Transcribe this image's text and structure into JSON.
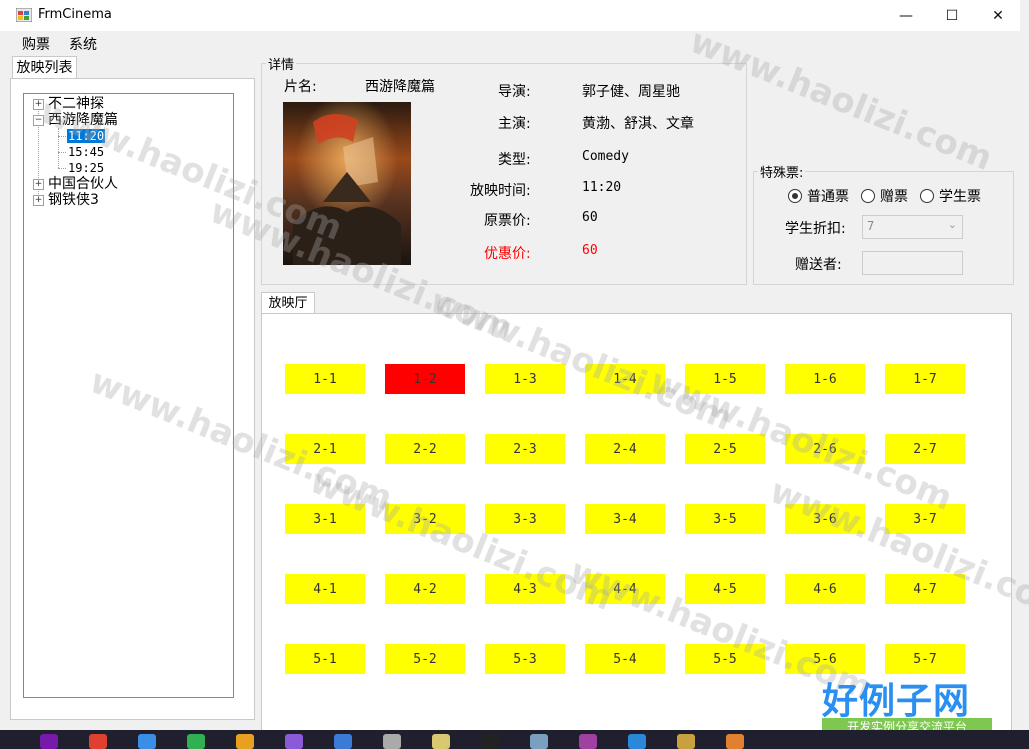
{
  "window": {
    "title": "FrmCinema",
    "minimize": "—",
    "maximize": "☐",
    "close": "✕"
  },
  "menu": [
    {
      "label": "购票"
    },
    {
      "label": "系统"
    }
  ],
  "left": {
    "tab_label": "放映列表",
    "movies": [
      {
        "label": "不二神探",
        "expander": "+"
      },
      {
        "label": "西游降魔篇",
        "expander": "−",
        "times": [
          "11:20",
          "15:45",
          "19:25"
        ]
      },
      {
        "label": "中国合伙人",
        "expander": "+"
      },
      {
        "label": "钢铁侠3",
        "expander": "+"
      }
    ]
  },
  "detail": {
    "group_title": "详情",
    "name_label": "片名:",
    "name_value": "西游降魔篇",
    "director_label": "导演:",
    "director_value": "郭子健、周星驰",
    "actor_label": "主演:",
    "actor_value": "黄渤、舒淇、文章",
    "type_label": "类型:",
    "type_value": "Comedy",
    "time_label": "放映时间:",
    "time_value": "11:20",
    "price_label": "原票价:",
    "price_value": "60",
    "discount_label": "优惠价:",
    "discount_value": "60",
    "discount_color": "#ff0000"
  },
  "special": {
    "group_title": "特殊票:",
    "radios": [
      {
        "label": "普通票",
        "checked": true
      },
      {
        "label": "赠票",
        "checked": false
      },
      {
        "label": "学生票",
        "checked": false
      }
    ],
    "student_discount_label": "学生折扣:",
    "student_discount_value": "7",
    "gift_label": "赠送者:",
    "gift_value": ""
  },
  "hall": {
    "tab_label": "放映厅",
    "seat_color": "#ffff00",
    "sold_color": "#ff0000",
    "rows": [
      [
        {
          "label": "1-1",
          "sold": false
        },
        {
          "label": "1-2",
          "sold": true
        },
        {
          "label": "1-3",
          "sold": false
        },
        {
          "label": "1-4",
          "sold": false
        },
        {
          "label": "1-5",
          "sold": false
        },
        {
          "label": "1-6",
          "sold": false
        },
        {
          "label": "1-7",
          "sold": false
        }
      ],
      [
        {
          "label": "2-1",
          "sold": false
        },
        {
          "label": "2-2",
          "sold": false
        },
        {
          "label": "2-3",
          "sold": false
        },
        {
          "label": "2-4",
          "sold": false
        },
        {
          "label": "2-5",
          "sold": false
        },
        {
          "label": "2-6",
          "sold": false
        },
        {
          "label": "2-7",
          "sold": false
        }
      ],
      [
        {
          "label": "3-1",
          "sold": false
        },
        {
          "label": "3-2",
          "sold": false
        },
        {
          "label": "3-3",
          "sold": false
        },
        {
          "label": "3-4",
          "sold": false
        },
        {
          "label": "3-5",
          "sold": false
        },
        {
          "label": "3-6",
          "sold": false
        },
        {
          "label": "3-7",
          "sold": false
        }
      ],
      [
        {
          "label": "4-1",
          "sold": false
        },
        {
          "label": "4-2",
          "sold": false
        },
        {
          "label": "4-3",
          "sold": false
        },
        {
          "label": "4-4",
          "sold": false
        },
        {
          "label": "4-5",
          "sold": false
        },
        {
          "label": "4-6",
          "sold": false
        },
        {
          "label": "4-7",
          "sold": false
        }
      ],
      [
        {
          "label": "5-1",
          "sold": false
        },
        {
          "label": "5-2",
          "sold": false
        },
        {
          "label": "5-3",
          "sold": false
        },
        {
          "label": "5-4",
          "sold": false
        },
        {
          "label": "5-5",
          "sold": false
        },
        {
          "label": "5-6",
          "sold": false
        },
        {
          "label": "5-7",
          "sold": false
        }
      ]
    ]
  },
  "watermark": {
    "text": "www.haolizi.com",
    "logo": "好例子网",
    "logo_sub": "开发实例分享交流平台"
  },
  "taskbar": {
    "icons": [
      "onenote-icon",
      "chrome-icon",
      "xcode-icon",
      "green-app-icon",
      "store-icon",
      "visual-studio-icon",
      "vs-code-icon",
      "box-icon",
      "notepad-icon",
      "terminal-icon",
      "window-icon",
      "powershell-icon",
      "file-explorer-icon",
      "folder-icon",
      "active-app-icon"
    ]
  }
}
